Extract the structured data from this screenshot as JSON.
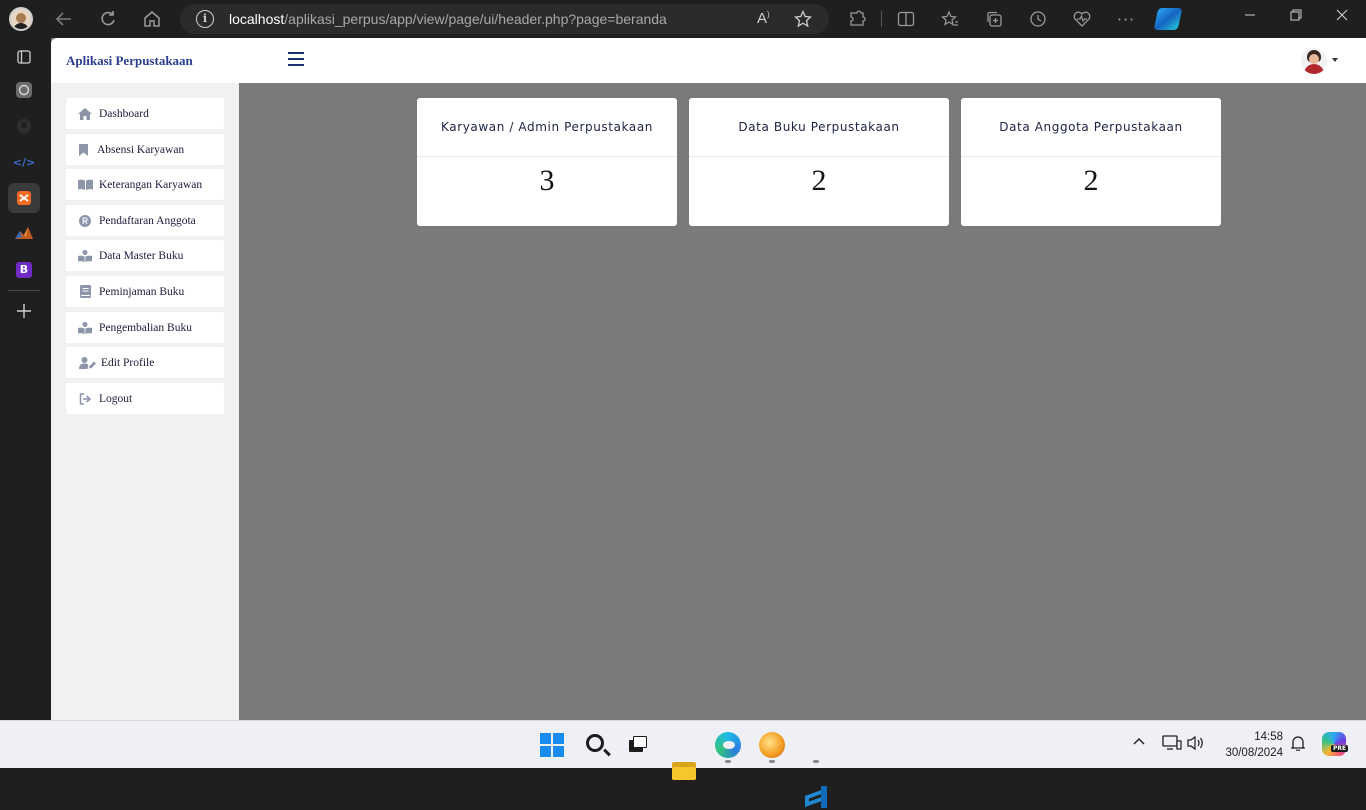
{
  "browser": {
    "url_host": "localhost",
    "url_path": "/aplikasi_perpus/app/view/page/ui/header.php?page=beranda",
    "read_aloud_label": "A",
    "icons": [
      "back-icon",
      "refresh-icon",
      "home-icon",
      "info-icon",
      "read-aloud-icon",
      "favorite-star-icon",
      "extensions-icon",
      "split-screen-icon",
      "favorites-icon",
      "collections-icon",
      "history-icon",
      "performance-icon",
      "more-icon",
      "copilot-icon",
      "minimize-icon",
      "restore-icon",
      "close-icon"
    ]
  },
  "rail": {
    "items": [
      "tab-actions-icon",
      "openai-icon",
      "github-icon",
      "devtools-icon",
      "xampp-icon",
      "matlab-icon",
      "bootstrap-icon",
      "add-icon"
    ],
    "bootstrap_label": "B"
  },
  "app": {
    "brand": "Aplikasi Perpustakaan",
    "sidebar": [
      {
        "label": "Dashboard",
        "icon": "home-icon"
      },
      {
        "label": "Absensi Karyawan",
        "icon": "bookmark-icon"
      },
      {
        "label": "Keterangan Karyawan",
        "icon": "open-book-icon"
      },
      {
        "label": "Pendaftaran Anggota",
        "icon": "registered-icon"
      },
      {
        "label": "Data Master Buku",
        "icon": "book-reader-icon"
      },
      {
        "label": "Peminjaman Buku",
        "icon": "book-icon"
      },
      {
        "label": "Pengembalian Buku",
        "icon": "book-reader-icon"
      },
      {
        "label": "Edit Profile",
        "icon": "user-edit-icon"
      },
      {
        "label": "Logout",
        "icon": "sign-out-icon"
      }
    ],
    "cards": [
      {
        "title": "Karyawan / Admin Perpustakaan",
        "value": "3"
      },
      {
        "title": "Data Buku Perpustakaan",
        "value": "2"
      },
      {
        "title": "Data Anggota Perpustakaan",
        "value": "2"
      }
    ]
  },
  "taskbar": {
    "apps": [
      "windows-start-icon",
      "search-icon",
      "task-view-icon",
      "file-explorer-icon",
      "edge-icon",
      "xampp-icon",
      "vscode-icon"
    ],
    "time": "14:58",
    "date": "30/08/2024",
    "copilot_badge": "PRE"
  }
}
